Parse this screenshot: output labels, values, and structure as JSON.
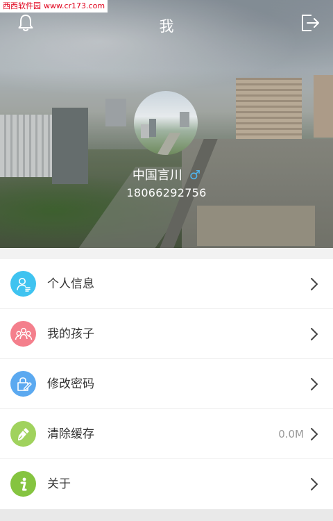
{
  "watermark": {
    "site": "西西软件园",
    "url": "www.cr173.com"
  },
  "header": {
    "title": "我"
  },
  "profile": {
    "name": "中国言川",
    "gender_symbol": "♂",
    "phone": "18066292756"
  },
  "menu": [
    {
      "id": "profile",
      "label": "个人信息",
      "value": "",
      "icon": "person-icon",
      "color": "#3fc3f0"
    },
    {
      "id": "children",
      "label": "我的孩子",
      "value": "",
      "icon": "group-icon",
      "color": "#f47f8c"
    },
    {
      "id": "password",
      "label": "修改密码",
      "value": "",
      "icon": "lock-edit-icon",
      "color": "#5ba9f0"
    },
    {
      "id": "cache",
      "label": "清除缓存",
      "value": "0.0M",
      "icon": "broom-icon",
      "color": "#a0d25d"
    },
    {
      "id": "about",
      "label": "关于",
      "value": "",
      "icon": "info-icon",
      "color": "#85c440"
    }
  ]
}
